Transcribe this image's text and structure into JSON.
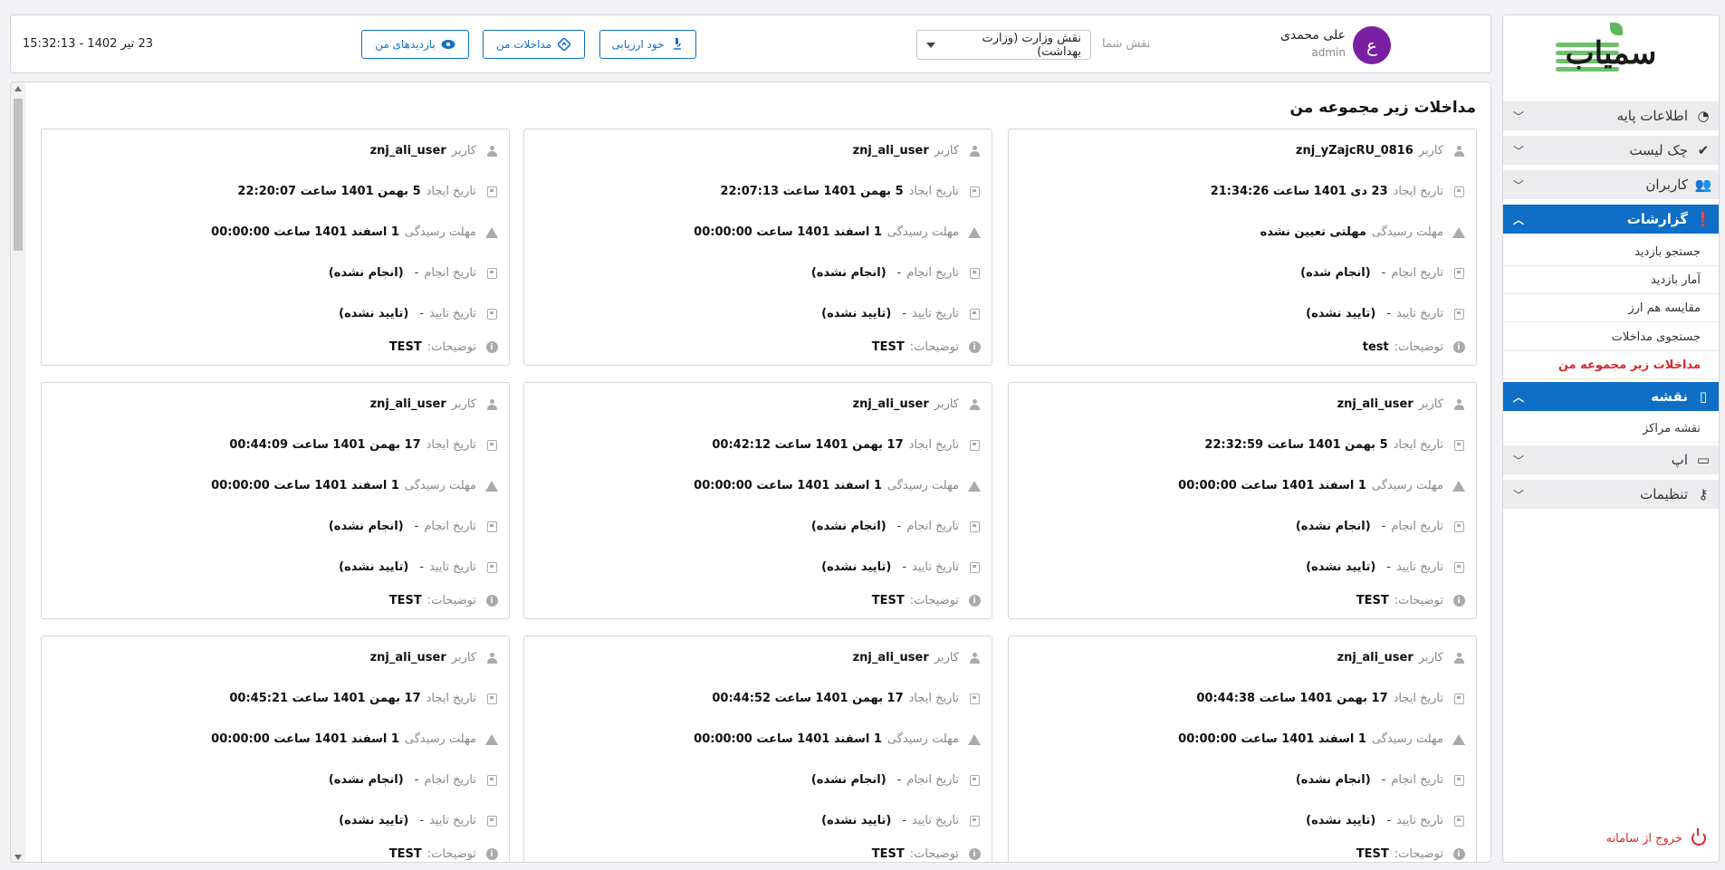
{
  "app": {
    "logo_text": "سمیاب"
  },
  "sidebar": {
    "groups": [
      {
        "label": "اطلاعات پایه",
        "icon": "pie-chart-icon"
      },
      {
        "label": "چک لیست",
        "icon": "check-circle-icon"
      },
      {
        "label": "کاربران",
        "icon": "users-icon"
      },
      {
        "label": "گزارشات",
        "icon": "alert-circle-icon",
        "active": true
      },
      {
        "label": "نقشه",
        "icon": "map-icon",
        "active": true
      },
      {
        "label": "اپ",
        "icon": "mobile-icon"
      },
      {
        "label": "تنظیمات",
        "icon": "key-icon"
      }
    ],
    "report_items": [
      "جستجو بازدید",
      "آمار بازدید",
      "مقایسه هم ارز",
      "جستجوی مداخلات",
      "مداخلات زیر مجموعه من"
    ],
    "map_items": [
      "نقشه مراکز"
    ],
    "logout": "خروج از سامانه"
  },
  "header": {
    "datetime": "23 تیر 1402 - 15:32:13",
    "buttons": {
      "my_visits": "بازدیدهای من",
      "my_interventions": "مداخلات من",
      "self_assessment": "خود ارزیابی"
    },
    "role_label": "نقش شما",
    "role_value": "نقش وزارت (وزارت بهداشت)",
    "user_name": "علی محمدی",
    "user_role": "admin",
    "avatar_letter": "ع"
  },
  "main": {
    "title": "مداخلات زیر مجموعه من"
  },
  "labels": {
    "user": "کاربر",
    "created": "تاریخ ایجاد",
    "deadline": "مهلت رسیدگی",
    "done_date": "تاریخ انجام",
    "confirm_date": "تاریخ تایید",
    "description": "توضیحات:",
    "dash": "-"
  },
  "cards": [
    {
      "user": "znj_yZajcRU_0816",
      "created": "23 دی 1401 ساعت 21:34:26",
      "deadline": "مهلتی تعیین نشده",
      "done_status": "(انجام شده)",
      "done_ok": true,
      "confirm_status": "(تایید نشده)",
      "description": "test"
    },
    {
      "user": "znj_ali_user",
      "created": "5 بهمن 1401 ساعت 22:07:13",
      "deadline": "1 اسفند 1401 ساعت 00:00:00",
      "done_status": "(انجام نشده)",
      "done_ok": false,
      "confirm_status": "(تایید نشده)",
      "description": "TEST"
    },
    {
      "user": "znj_ali_user",
      "created": "5 بهمن 1401 ساعت 22:20:07",
      "deadline": "1 اسفند 1401 ساعت 00:00:00",
      "done_status": "(انجام نشده)",
      "done_ok": false,
      "confirm_status": "(تایید نشده)",
      "description": "TEST"
    },
    {
      "user": "znj_ali_user",
      "created": "5 بهمن 1401 ساعت 22:32:59",
      "deadline": "1 اسفند 1401 ساعت 00:00:00",
      "done_status": "(انجام نشده)",
      "done_ok": false,
      "confirm_status": "(تایید نشده)",
      "description": "TEST"
    },
    {
      "user": "znj_ali_user",
      "created": "17 بهمن 1401 ساعت 00:42:12",
      "deadline": "1 اسفند 1401 ساعت 00:00:00",
      "done_status": "(انجام نشده)",
      "done_ok": false,
      "confirm_status": "(تایید نشده)",
      "description": "TEST"
    },
    {
      "user": "znj_ali_user",
      "created": "17 بهمن 1401 ساعت 00:44:09",
      "deadline": "1 اسفند 1401 ساعت 00:00:00",
      "done_status": "(انجام نشده)",
      "done_ok": false,
      "confirm_status": "(تایید نشده)",
      "description": "TEST"
    },
    {
      "user": "znj_ali_user",
      "created": "17 بهمن 1401 ساعت 00:44:38",
      "deadline": "1 اسفند 1401 ساعت 00:00:00",
      "done_status": "(انجام نشده)",
      "done_ok": false,
      "confirm_status": "(تایید نشده)",
      "description": "TEST"
    },
    {
      "user": "znj_ali_user",
      "created": "17 بهمن 1401 ساعت 00:44:52",
      "deadline": "1 اسفند 1401 ساعت 00:00:00",
      "done_status": "(انجام نشده)",
      "done_ok": false,
      "confirm_status": "(تایید نشده)",
      "description": "TEST"
    },
    {
      "user": "znj_ali_user",
      "created": "17 بهمن 1401 ساعت 00:45:21",
      "deadline": "1 اسفند 1401 ساعت 00:00:00",
      "done_status": "(انجام نشده)",
      "done_ok": false,
      "confirm_status": "(تایید نشده)",
      "description": "TEST"
    }
  ],
  "colors": {
    "accent": "#0f6fc6",
    "danger": "#d9262b",
    "success": "#2e7d32",
    "avatar": "#7b1fa2"
  }
}
